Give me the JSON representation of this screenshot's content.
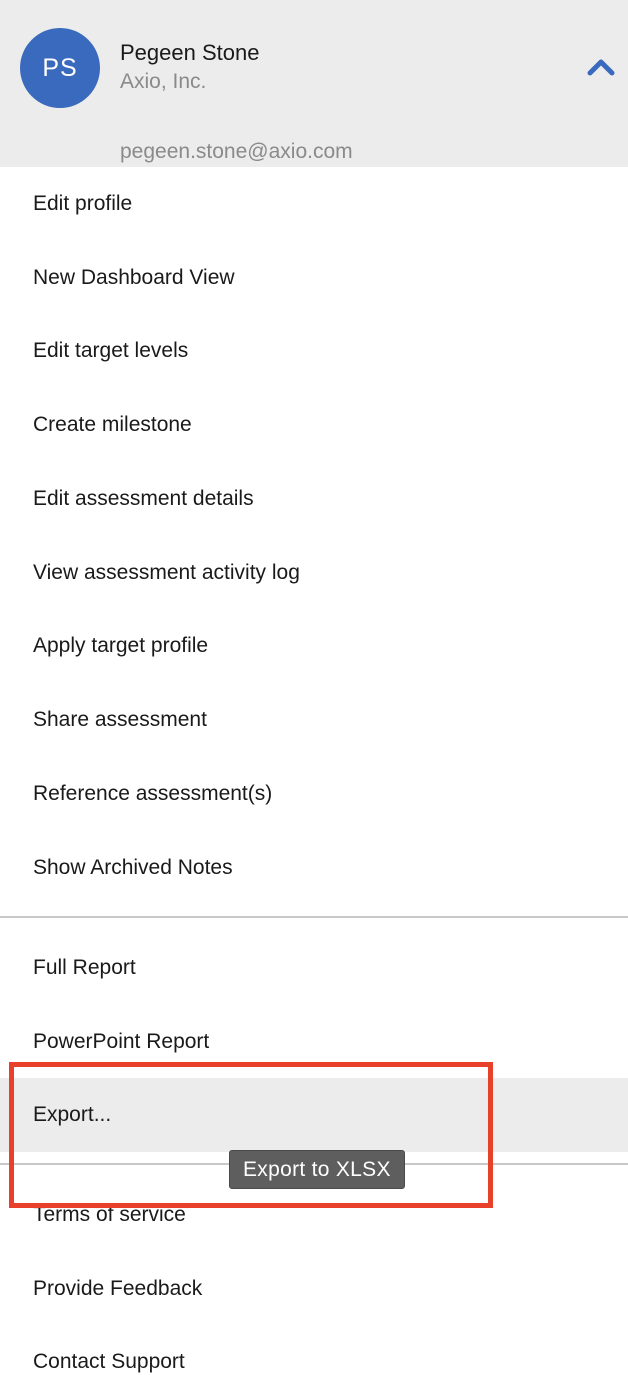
{
  "user": {
    "initials": "PS",
    "name": "Pegeen Stone",
    "organization": "Axio, Inc.",
    "email": "pegeen.stone@axio.com"
  },
  "icons": {
    "collapse": "chevron-up-icon"
  },
  "colors": {
    "avatar": "#3a6abd",
    "header_bg": "#ececec",
    "highlight": "#e8402a",
    "tooltip_bg": "#5e5e5e"
  },
  "menu": {
    "section_main": [
      "Edit profile",
      "New Dashboard View",
      "Edit target levels",
      "Create milestone",
      "Edit assessment details",
      "View assessment activity log",
      "Apply target profile",
      "Share assessment",
      "Reference assessment(s)",
      "Show Archived Notes"
    ],
    "section_reports": [
      "Full Report",
      "PowerPoint Report",
      "Export..."
    ],
    "section_support": [
      "Terms of service",
      "Provide Feedback",
      "Contact Support"
    ]
  },
  "tooltip": {
    "text": "Export to XLSX"
  }
}
